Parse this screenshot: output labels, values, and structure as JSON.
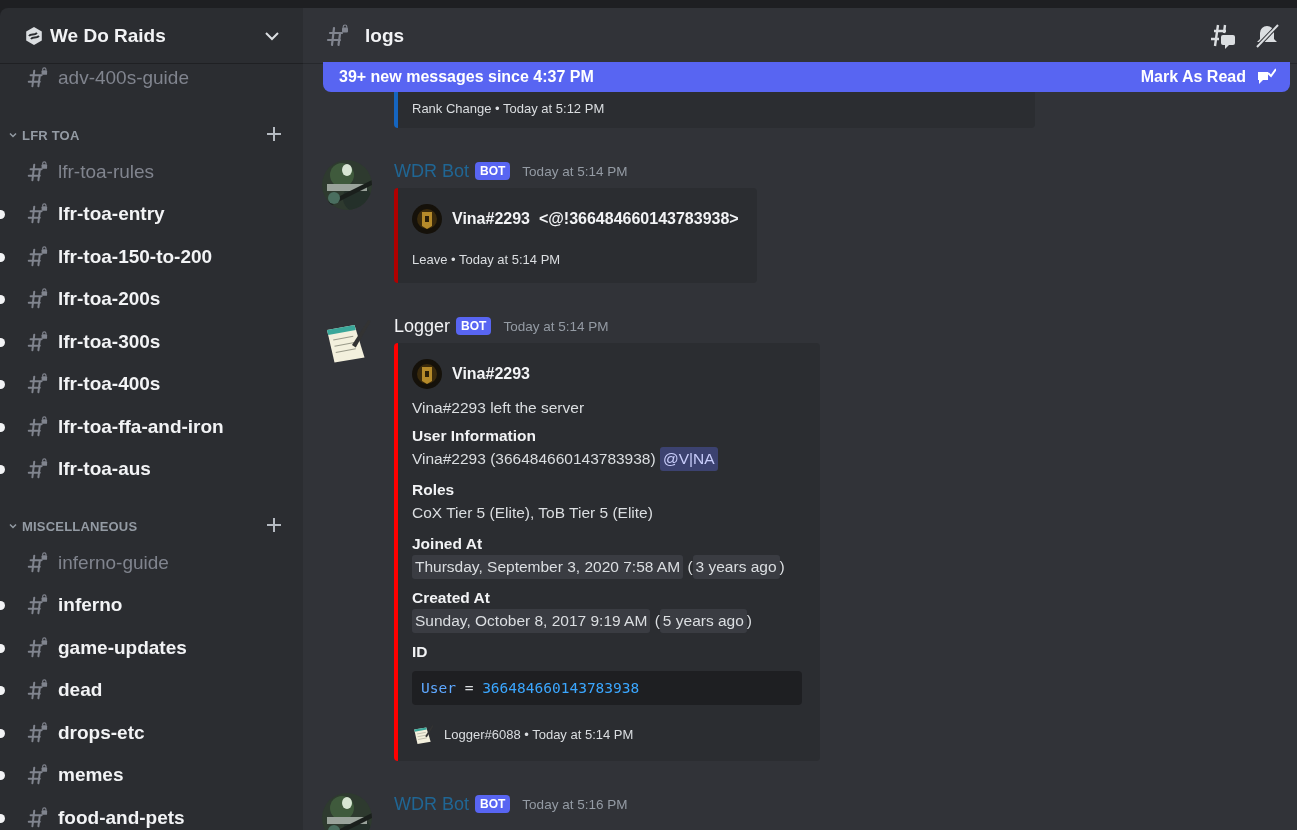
{
  "server": {
    "name": "We Do Raids"
  },
  "sidebar": {
    "top_channels": [
      {
        "name": "adv-400s-guide",
        "unread": false
      }
    ],
    "categories": [
      {
        "name": "LFR TOA",
        "expanded": true,
        "channels": [
          {
            "name": "lfr-toa-rules",
            "unread": false
          },
          {
            "name": "lfr-toa-entry",
            "unread": true
          },
          {
            "name": "lfr-toa-150-to-200",
            "unread": true
          },
          {
            "name": "lfr-toa-200s",
            "unread": true
          },
          {
            "name": "lfr-toa-300s",
            "unread": true
          },
          {
            "name": "lfr-toa-400s",
            "unread": true
          },
          {
            "name": "lfr-toa-ffa-and-iron",
            "unread": true
          },
          {
            "name": "lfr-toa-aus",
            "unread": true
          }
        ]
      },
      {
        "name": "MISCELLANEOUS",
        "expanded": true,
        "channels": [
          {
            "name": "inferno-guide",
            "unread": false
          },
          {
            "name": "inferno",
            "unread": true
          },
          {
            "name": "game-updates",
            "unread": true
          },
          {
            "name": "dead",
            "unread": true
          },
          {
            "name": "drops-etc",
            "unread": true
          },
          {
            "name": "memes",
            "unread": true
          },
          {
            "name": "food-and-pets",
            "unread": true
          }
        ]
      }
    ]
  },
  "header": {
    "channel": "logs"
  },
  "banner": {
    "text": "39+ new messages since 4:37 PM",
    "action": "Mark As Read"
  },
  "messages": [
    {
      "kind": "fragment",
      "embed": {
        "color": "#1565c0",
        "footer": "Rank Change • Today at 5:12 PM"
      }
    },
    {
      "kind": "full",
      "author": "WDR Bot",
      "color": "#206694",
      "tag": "BOT",
      "time": "Today at 5:14 PM",
      "embed": {
        "color": "#b00000",
        "author": "Vina#2293  <@!366484660143783938>",
        "footer": "Leave • Today at 5:14 PM"
      }
    },
    {
      "kind": "full",
      "author": "Logger",
      "color": "#f2f3f5",
      "avatar": {
        "kind": "notepad"
      },
      "tag": "BOT",
      "time": "Today at 5:14 PM",
      "embed": {
        "color": "#ff0000",
        "author": "Vina#2293",
        "description": "Vina#2293 left the server",
        "fields": [
          {
            "name": "User Information",
            "parts": [
              {
                "kind": "text",
                "text": "Vina#2293 (366484660143783938) "
              },
              {
                "kind": "mention",
                "text": "@V|NA"
              }
            ]
          },
          {
            "name": "Roles",
            "parts": [
              {
                "kind": "text",
                "text": "CoX Tier 5 (Elite), ToB Tier 5 (Elite)"
              }
            ]
          },
          {
            "name": "Joined At",
            "parts": [
              {
                "kind": "timestamp",
                "text": "Thursday, September 3, 2020 7:58 AM"
              },
              {
                "kind": "text",
                "text": " ("
              },
              {
                "kind": "timestamp",
                "text": "3 years ago"
              },
              {
                "kind": "text",
                "text": ")"
              }
            ]
          },
          {
            "name": "Created At",
            "parts": [
              {
                "kind": "timestamp",
                "text": "Sunday, October 8, 2017 9:19 AM"
              },
              {
                "kind": "text",
                "text": " ("
              },
              {
                "kind": "timestamp",
                "text": "5 years ago"
              },
              {
                "kind": "text",
                "text": ")"
              }
            ]
          },
          {
            "name": "ID",
            "parts": [
              {
                "kind": "code",
                "tokens": [
                  {
                    "text": "User",
                    "color": "#5ea8ff"
                  },
                  {
                    "text": " = ",
                    "color": "#dbdee1"
                  },
                  {
                    "text": "366484660143783938",
                    "color": "#3ba7ff"
                  }
                ]
              }
            ]
          }
        ],
        "footer_icon": {
          "kind": "notepad"
        },
        "footer": "Logger#6088 • Today at 5:14 PM"
      }
    },
    {
      "kind": "full",
      "author": "WDR Bot",
      "color": "#206694",
      "tag": "BOT",
      "time": "Today at 5:16 PM"
    }
  ]
}
